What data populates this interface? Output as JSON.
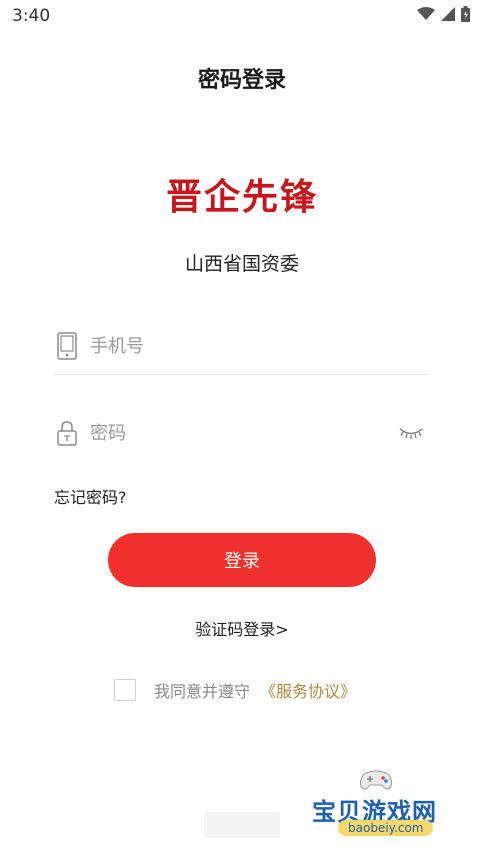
{
  "status_bar": {
    "time": "3:40",
    "icons": [
      "wifi-icon",
      "signal-icon",
      "battery-icon"
    ]
  },
  "page": {
    "title": "密码登录"
  },
  "logo": {
    "text": "晋企先锋",
    "color": "#c8161d"
  },
  "organization": {
    "name": "山西省国资委"
  },
  "phone_field": {
    "placeholder": "手机号",
    "value": "",
    "icon": "phone-icon"
  },
  "password_field": {
    "placeholder": "密码",
    "value": "",
    "icon": "lock-icon",
    "toggle_icon": "eye-closed-icon"
  },
  "forgot_password": {
    "label": "忘记密码?"
  },
  "login_button": {
    "label": "登录",
    "color": "#f0302d"
  },
  "sms_login": {
    "label": "验证码登录>"
  },
  "agreement": {
    "checked": false,
    "text": "我同意并遵守",
    "link_label": "《服务协议》",
    "link_color": "#b08a3e"
  },
  "watermark": {
    "title": "宝贝游戏网",
    "url": "baobeiy.com"
  }
}
